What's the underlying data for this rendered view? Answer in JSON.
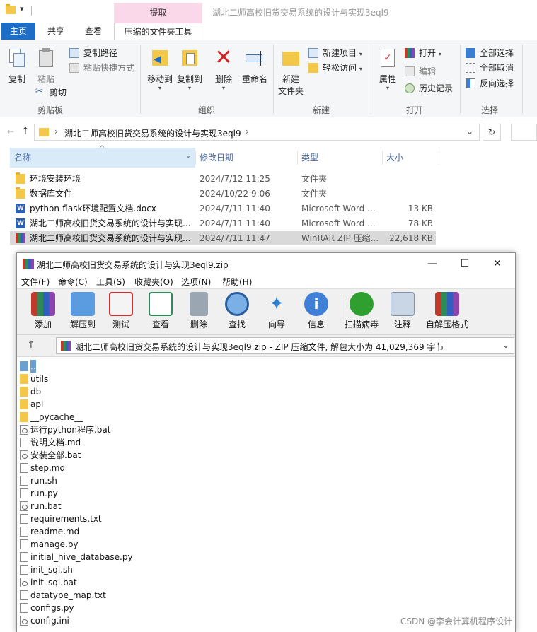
{
  "explorer": {
    "title": "湖北二师高校旧货交易系统的设计与实现3eql9",
    "context_tab": "提取",
    "tabs": {
      "home": "主页",
      "share": "共享",
      "view": "查看",
      "tools": "压缩的文件夹工具"
    },
    "ribbon": {
      "clipboard": {
        "label": "剪贴板",
        "copy": "复制",
        "paste": "粘贴",
        "copy_path": "复制路径",
        "paste_shortcut": "粘贴快捷方式",
        "cut": "剪切"
      },
      "organize": {
        "label": "组织",
        "move_to": "移动到",
        "copy_to": "复制到",
        "delete": "删除",
        "rename": "重命名"
      },
      "new": {
        "label": "新建",
        "new_folder_line1": "新建",
        "new_folder_line2": "文件夹",
        "new_item": "新建项目",
        "easy_access": "轻松访问"
      },
      "open": {
        "label": "打开",
        "properties": "属性",
        "open": "打开",
        "edit": "编辑",
        "history": "历史记录"
      },
      "select": {
        "label": "选择",
        "select_all": "全部选择",
        "select_none": "全部取消",
        "invert": "反向选择"
      }
    },
    "address": {
      "path": "湖北二师高校旧货交易系统的设计与实现3eql9"
    },
    "columns": {
      "name": "名称",
      "date": "修改日期",
      "type": "类型",
      "size": "大小"
    },
    "files": [
      {
        "name": "环境安装环境",
        "date": "2024/7/12 11:25",
        "type": "文件夹",
        "size": "",
        "icon": "folder-icon"
      },
      {
        "name": "数据库文件",
        "date": "2024/10/22 9:06",
        "type": "文件夹",
        "size": "",
        "icon": "folder-icon"
      },
      {
        "name": "python-flask环境配置文档.docx",
        "date": "2024/7/11 11:40",
        "type": "Microsoft Word ...",
        "size": "13 KB",
        "icon": "word-icon"
      },
      {
        "name": "湖北二师高校旧货交易系统的设计与实现...",
        "date": "2024/7/11 11:40",
        "type": "Microsoft Word ...",
        "size": "78 KB",
        "icon": "word-icon"
      },
      {
        "name": "湖北二师高校旧货交易系统的设计与实现...",
        "date": "2024/7/11 11:47",
        "type": "WinRAR ZIP 压缩...",
        "size": "22,618 KB",
        "icon": "winrar-icon"
      }
    ]
  },
  "winrar": {
    "title": "湖北二师高校旧货交易系统的设计与实现3eql9.zip",
    "menu": [
      "文件(F)",
      "命令(C)",
      "工具(S)",
      "收藏夹(O)",
      "选项(N)",
      "帮助(H)"
    ],
    "toolbar": [
      "添加",
      "解压到",
      "测试",
      "查看",
      "删除",
      "查找",
      "向导",
      "信息",
      "扫描病毒",
      "注释",
      "自解压格式"
    ],
    "path": "湖北二师高校旧货交易系统的设计与实现3eql9.zip - ZIP 压缩文件, 解包大小为 41,029,369 字节",
    "entries": [
      {
        "name": "..",
        "kind": "up"
      },
      {
        "name": "utils",
        "kind": "fold"
      },
      {
        "name": "db",
        "kind": "fold"
      },
      {
        "name": "api",
        "kind": "fold"
      },
      {
        "name": "__pycache__",
        "kind": "fold"
      },
      {
        "name": "运行python程序.bat",
        "kind": "bat"
      },
      {
        "name": "说明文档.md",
        "kind": "doc"
      },
      {
        "name": "安装全部.bat",
        "kind": "bat"
      },
      {
        "name": "step.md",
        "kind": "doc"
      },
      {
        "name": "run.sh",
        "kind": "doc"
      },
      {
        "name": "run.py",
        "kind": "doc"
      },
      {
        "name": "run.bat",
        "kind": "bat"
      },
      {
        "name": "requirements.txt",
        "kind": "doc"
      },
      {
        "name": "readme.md",
        "kind": "doc"
      },
      {
        "name": "manage.py",
        "kind": "doc"
      },
      {
        "name": "initial_hive_database.py",
        "kind": "doc"
      },
      {
        "name": "init_sql.sh",
        "kind": "doc"
      },
      {
        "name": "init_sql.bat",
        "kind": "bat"
      },
      {
        "name": "datatype_map.txt",
        "kind": "doc"
      },
      {
        "name": "configs.py",
        "kind": "doc"
      },
      {
        "name": "config.ini",
        "kind": "bat"
      }
    ]
  },
  "watermark": "CSDN @李会计算机程序设计",
  "colors": {
    "accent": "#1e6ec8",
    "context_tab": "#fbd7ea",
    "selection": "#cce8ff"
  }
}
